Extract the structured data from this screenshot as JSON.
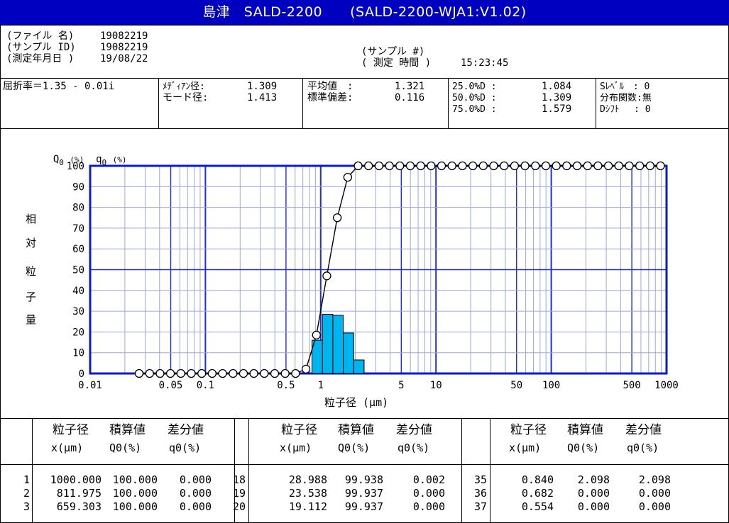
{
  "title": "島津　SALD-2200　　(SALD-2200-WJA1:V1.02)",
  "header": {
    "file_label": "(ファイル 名)",
    "file_value": "19082219",
    "sample_id_label": "(サンプル ID)",
    "sample_id_value": "19082219",
    "date_label": "(測定年月日 )",
    "date_value": "19/08/22",
    "sample_no_label": "(サンプル #)",
    "time_label": "( 測定 時間 )",
    "time_value": "15:23:45"
  },
  "stats": {
    "refractive": "屈折率＝1.35 - 0.01i",
    "median_label": "ﾒﾃﾞｨｱﾝ径:",
    "median_value": "1.309",
    "mode_label": "モード径:",
    "mode_value": "1.413",
    "mean_label": "平均値　:",
    "mean_value": "1.321",
    "std_label": "標準偏差:",
    "std_value": "0.116",
    "d25_label": "25.0%D :",
    "d25_value": "1.084",
    "d50_label": "50.0%D :",
    "d50_value": "1.309",
    "d75_label": "75.0%D :",
    "d75_value": "1.579",
    "slevel": "Sﾚﾍﾞﾙ　: 0",
    "dist_func": "分布関数:無",
    "dshift": "Dｼﾌﾄ　 : 0"
  },
  "chart_data": {
    "type": "bar",
    "title": "",
    "axis_labels": {
      "q_label": "Q",
      "q_sub": "0",
      "q_unit": "(%)",
      "qd_label": "q",
      "qd_sub": "0",
      "qd_unit": "(%)",
      "ylabel_chars": [
        "相",
        "対",
        "粒",
        "子",
        "量"
      ],
      "xlabel": "粒子径 (μm)"
    },
    "xlabel": "粒子径 (μm)",
    "x_scale": "log",
    "xlim": [
      0.01,
      1000
    ],
    "ylim": [
      0,
      100
    ],
    "y_ticks": [
      0,
      10,
      20,
      30,
      40,
      50,
      60,
      70,
      80,
      90,
      100
    ],
    "x_tick_labels": [
      {
        "value": 0.01,
        "label": "0.01"
      },
      {
        "value": 0.05,
        "label": "0.05"
      },
      {
        "value": 0.1,
        "label": "0.1"
      },
      {
        "value": 0.5,
        "label": "0.5"
      },
      {
        "value": 1,
        "label": "1"
      },
      {
        "value": 5,
        "label": "5"
      },
      {
        "value": 10,
        "label": "10"
      },
      {
        "value": 50,
        "label": "50"
      },
      {
        "value": 100,
        "label": "100"
      },
      {
        "value": 500,
        "label": "500"
      },
      {
        "value": 1000,
        "label": "1000"
      }
    ],
    "grid": true,
    "bars_q0": [
      {
        "x0": 0.84,
        "x1": 1.035,
        "value": 16.0
      },
      {
        "x0": 1.035,
        "x1": 1.274,
        "value": 28.5
      },
      {
        "x0": 1.274,
        "x1": 1.569,
        "value": 28.0
      },
      {
        "x0": 1.569,
        "x1": 1.932,
        "value": 19.5
      },
      {
        "x0": 1.932,
        "x1": 2.38,
        "value": 6.5
      }
    ],
    "bar_color": "#00b4f0",
    "line_Q0": {
      "x": [
        0.0266,
        0.0328,
        0.0404,
        0.0497,
        0.0612,
        0.0754,
        0.0929,
        0.1144,
        0.1409,
        0.1735,
        0.2137,
        0.2631,
        0.324,
        0.399,
        0.4914,
        0.6052,
        0.7453,
        0.918,
        1.13,
        1.392,
        1.715,
        2.112,
        2.6,
        3.203,
        3.944,
        4.858,
        5.983,
        7.368,
        9.074,
        11.176,
        13.764,
        16.951,
        20.877,
        25.712,
        31.666,
        39.0,
        48.031,
        59.154,
        72.853,
        89.725,
        110.5,
        136.09,
        167.61,
        206.42,
        254.23,
        313.1,
        385.61,
        474.91,
        584.89,
        720.34,
        887.16
      ],
      "y": [
        0,
        0,
        0,
        0,
        0,
        0,
        0,
        0,
        0,
        0,
        0,
        0,
        0,
        0,
        0,
        0,
        2.1,
        18.5,
        47.0,
        75.0,
        94.5,
        100,
        100,
        100,
        100,
        100,
        100,
        100,
        100,
        100,
        100,
        100,
        100,
        100,
        100,
        100,
        100,
        100,
        100,
        100,
        100,
        100,
        100,
        100,
        100,
        100,
        100,
        100,
        100,
        100,
        100
      ]
    }
  },
  "table": {
    "col_size": "粒子径",
    "col_cum": "積算値",
    "col_diff": "差分値",
    "unit_size": "x(μm)",
    "unit_cum": "Q0(%)",
    "unit_diff": "q0(%)",
    "groups": [
      {
        "rows": [
          {
            "n": "1",
            "x": "1000.000",
            "Q": "100.000",
            "q": "0.000"
          },
          {
            "n": "2",
            "x": "811.975",
            "Q": "100.000",
            "q": "0.000"
          },
          {
            "n": "3",
            "x": "659.303",
            "Q": "100.000",
            "q": "0.000"
          }
        ]
      },
      {
        "rows": [
          {
            "n": "18",
            "x": "28.988",
            "Q": "99.938",
            "q": "0.002"
          },
          {
            "n": "19",
            "x": "23.538",
            "Q": "99.937",
            "q": "0.000"
          },
          {
            "n": "20",
            "x": "19.112",
            "Q": "99.937",
            "q": "0.000"
          }
        ]
      },
      {
        "rows": [
          {
            "n": "35",
            "x": "0.840",
            "Q": "2.098",
            "q": "2.098"
          },
          {
            "n": "36",
            "x": "0.682",
            "Q": "0.000",
            "q": "0.000"
          },
          {
            "n": "37",
            "x": "0.554",
            "Q": "0.000",
            "q": "0.000"
          }
        ]
      }
    ]
  }
}
